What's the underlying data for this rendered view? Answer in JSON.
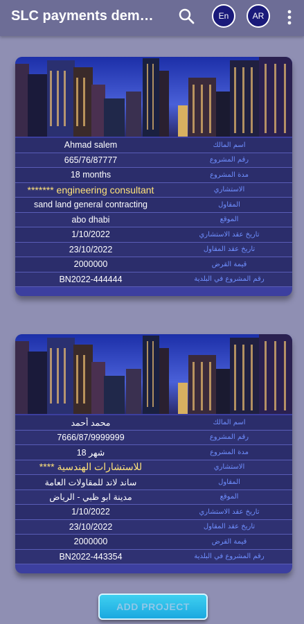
{
  "appbar": {
    "title": "SLC payments dem…",
    "lang_en_label": "En",
    "lang_ar_label": "AR"
  },
  "icons": {
    "search": "search-icon",
    "more": "more-vertical-icon"
  },
  "projects": [
    {
      "image": "city-skyline-image",
      "rows": [
        {
          "value": "Ahmad salem",
          "label": "اسم المالك"
        },
        {
          "value": "665/76/87777",
          "label": "رقم المشروع"
        },
        {
          "value": "18 months",
          "label": "مدة المشروع"
        },
        {
          "value": "******* engineering consultant",
          "label": "الاستشاري"
        },
        {
          "value": "sand land general contracting",
          "label": "المقاول"
        },
        {
          "value": "abo dhabi",
          "label": "الموقع"
        },
        {
          "value": "1/10/2022",
          "label": "تاريخ عقد الاستشاري"
        },
        {
          "value": "23/10/2022",
          "label": "تاريخ عقد المقاول"
        },
        {
          "value": "2000000",
          "label": "قيمة القرض"
        },
        {
          "value": "BN2022-444444",
          "label": "رقم المشروع في البلدية"
        }
      ]
    },
    {
      "image": "city-skyline-image",
      "rows": [
        {
          "value": "محمد أحمد",
          "label": "اسم المالك"
        },
        {
          "value": "7666/87/9999999",
          "label": "رقم المشروع"
        },
        {
          "value": "18 شهر",
          "label": "مدة المشروع"
        },
        {
          "value": "**** للاستشارات الهندسية",
          "label": "الاستشاري"
        },
        {
          "value": "ساند لاند للمقاولات العامة",
          "label": "المقاول"
        },
        {
          "value": "مدينة ابو ظبي - الرياض",
          "label": "الموقع"
        },
        {
          "value": "1/10/2022",
          "label": "تاريخ عقد الاستشاري"
        },
        {
          "value": "23/10/2022",
          "label": "تاريخ عقد المقاول"
        },
        {
          "value": "2000000",
          "label": "قيمة القرض"
        },
        {
          "value": "BN2022-443354",
          "label": "رقم المشروع في البلدية"
        }
      ]
    }
  ],
  "add_button_label": "ADD PROJECT",
  "colors": {
    "background": "#8f8fb3",
    "appbar": "#6d6d96",
    "card": "#3c3f9f",
    "label_text": "#6f8fff",
    "accent_button": "#1aa8e0"
  }
}
